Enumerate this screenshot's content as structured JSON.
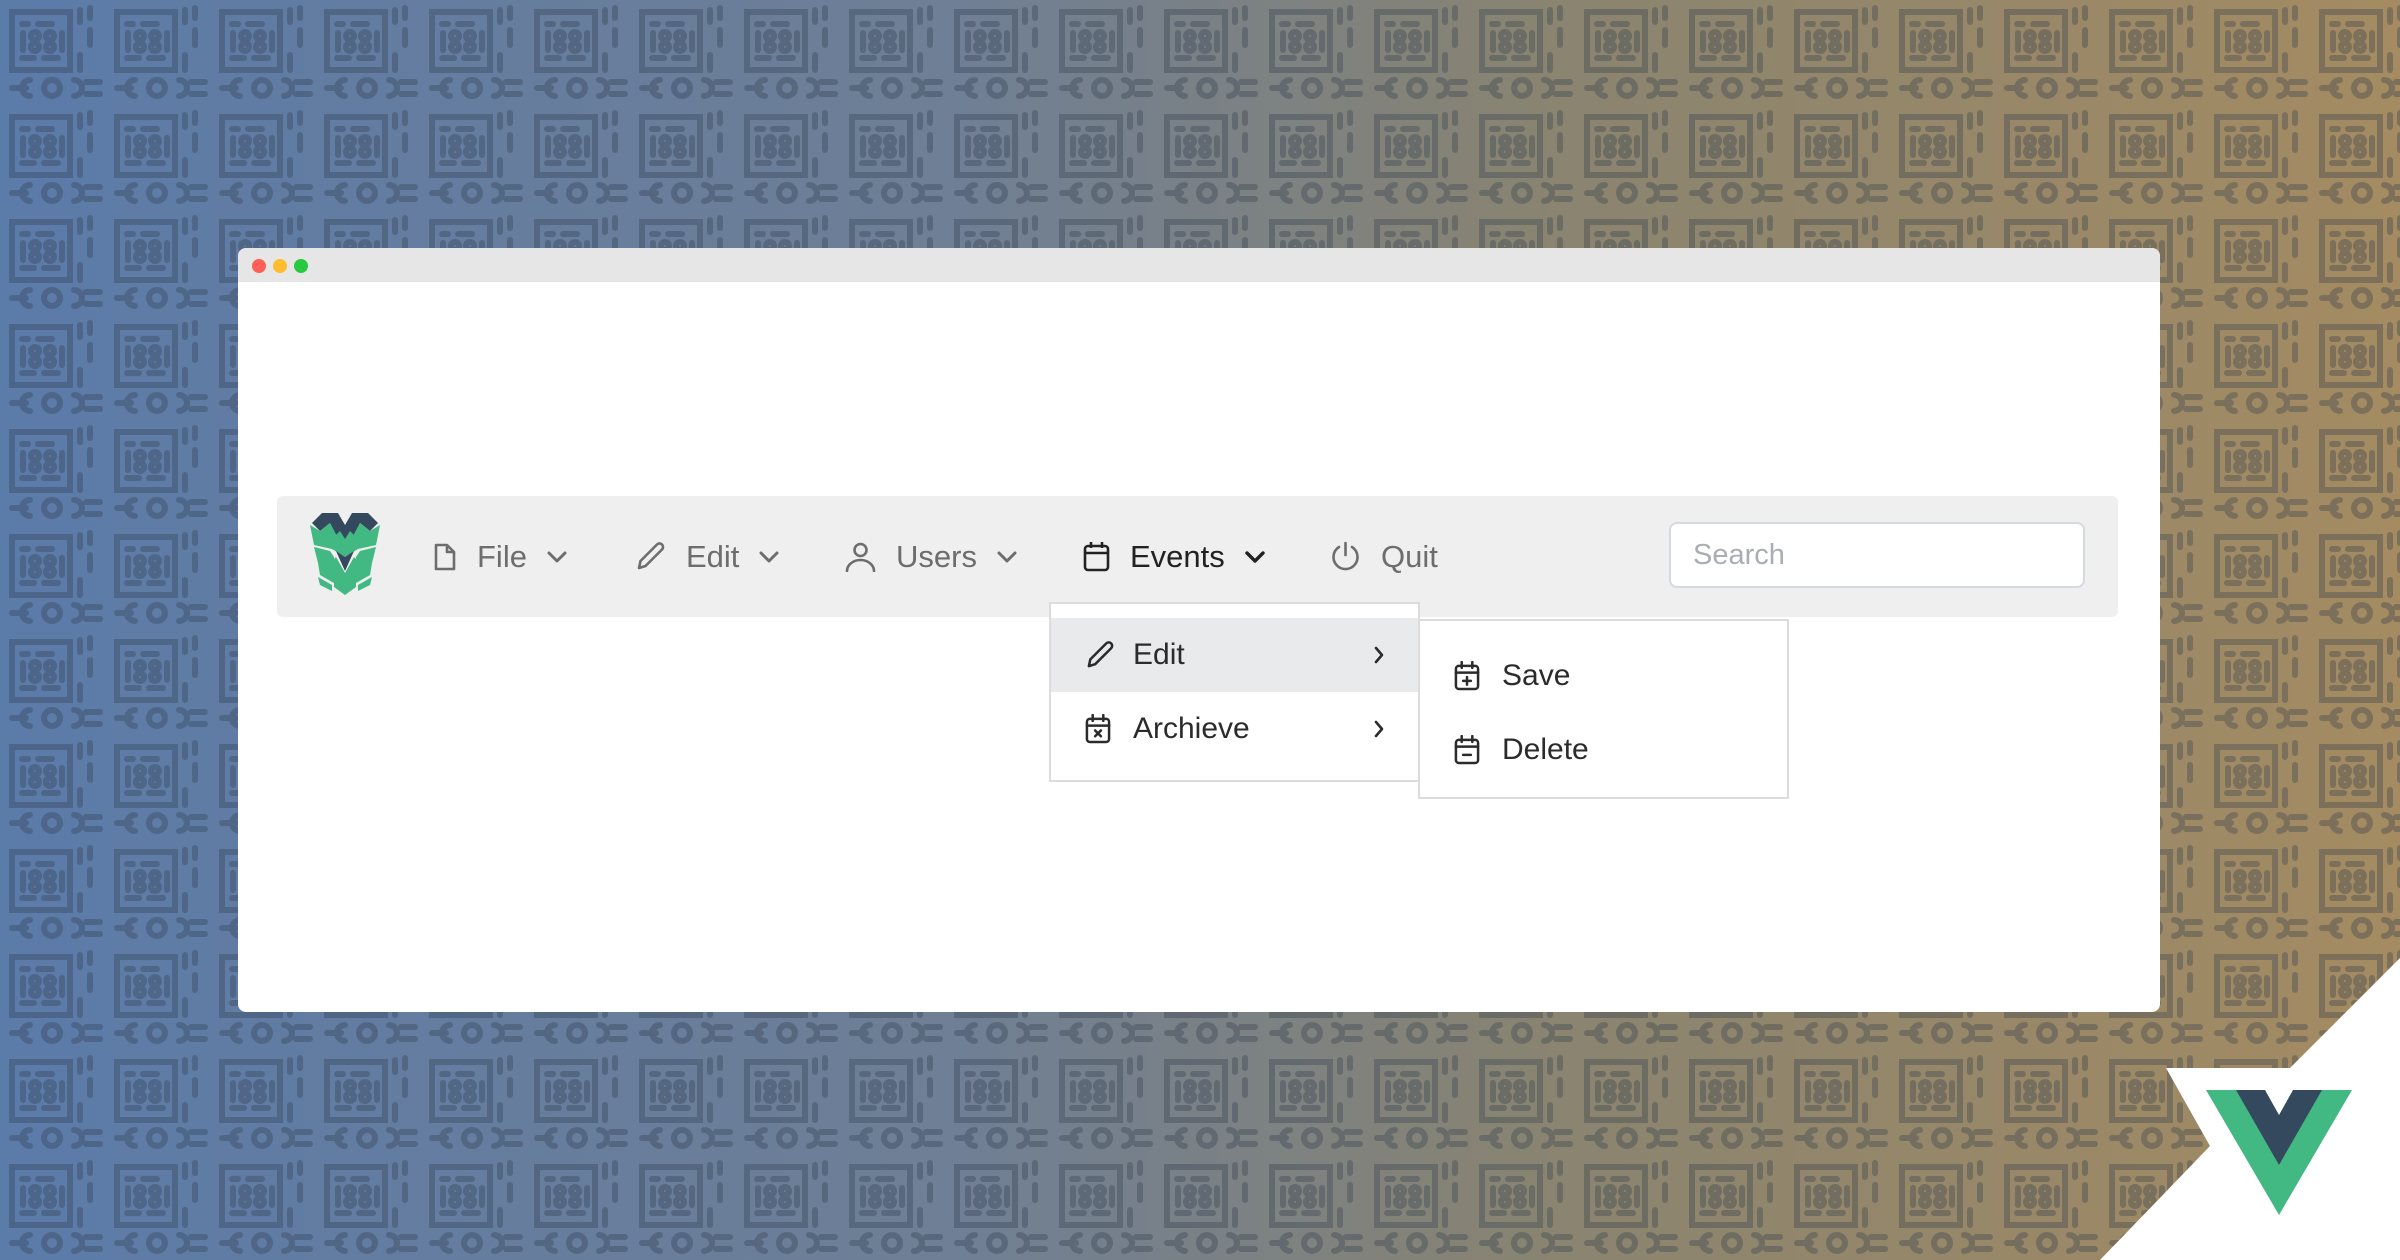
{
  "window": {
    "controls": [
      "close",
      "minimize",
      "maximize"
    ]
  },
  "navbar": {
    "logo": "vue-robot-logo",
    "items": [
      {
        "label": "File",
        "icon": "file-icon",
        "has_dropdown": true,
        "active": false
      },
      {
        "label": "Edit",
        "icon": "pencil-icon",
        "has_dropdown": true,
        "active": false
      },
      {
        "label": "Users",
        "icon": "user-icon",
        "has_dropdown": true,
        "active": false
      },
      {
        "label": "Events",
        "icon": "calendar-icon",
        "has_dropdown": true,
        "active": true
      },
      {
        "label": "Quit",
        "icon": "power-icon",
        "has_dropdown": false,
        "active": false
      }
    ],
    "search": {
      "placeholder": "Search",
      "value": ""
    }
  },
  "events_menu": {
    "items": [
      {
        "label": "Edit",
        "icon": "pencil-icon",
        "has_submenu": true,
        "highlighted": true
      },
      {
        "label": "Archieve",
        "icon": "calendar-x-icon",
        "has_submenu": true,
        "highlighted": false
      }
    ]
  },
  "edit_submenu": {
    "items": [
      {
        "label": "Save",
        "icon": "calendar-plus-icon"
      },
      {
        "label": "Delete",
        "icon": "calendar-minus-icon"
      }
    ]
  },
  "colors": {
    "vue_green": "#42b883",
    "vue_dark": "#35495e",
    "menu_highlight": "#e8eaec",
    "navbar_bg": "#efefef"
  }
}
